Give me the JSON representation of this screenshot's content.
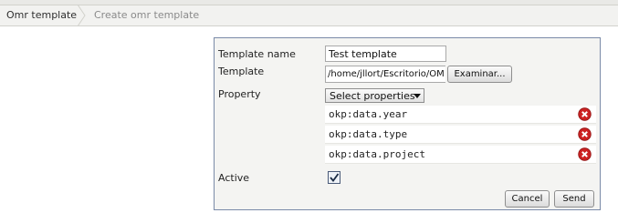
{
  "breadcrumb": {
    "home": "Omr template",
    "current": "Create omr template"
  },
  "form": {
    "template_name_label": "Template name",
    "template_name_value": "Test template",
    "template_label": "Template",
    "template_path_value": "/home/jllort/Escritorio/OMR",
    "browse_button": "Examinar...",
    "property_label": "Property",
    "property_select_value": "Select properties",
    "properties": [
      "okp:data.year",
      "okp:data.type",
      "okp:data.project"
    ],
    "active_label": "Active",
    "active_checked": true,
    "cancel_button": "Cancel",
    "send_button": "Send"
  },
  "icons": {
    "remove": "remove-circle-icon",
    "dropdown": "chevron-down-icon",
    "checkbox": "checkmark-icon"
  },
  "colors": {
    "remove_icon": "#cc2222",
    "panel_border": "#7a8aa8",
    "checkbox_border": "#4a5a78"
  }
}
